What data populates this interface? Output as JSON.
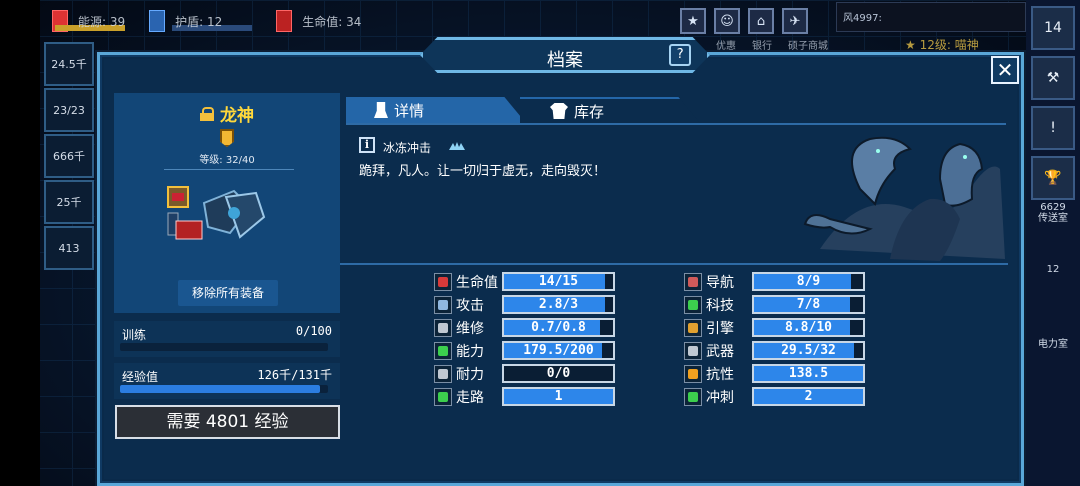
{
  "hud": {
    "energy": "能源: 39",
    "shield": "护盾: 12",
    "health": "生命值: 34",
    "buttons": [
      "★",
      "☺",
      "⌂",
      "✈"
    ],
    "button_labels": [
      "优惠",
      "银行",
      "硕子商城"
    ],
    "player_id": "风4997:",
    "rank": "★ 12级: 喵神"
  },
  "left_side": [
    "24.5千",
    "23/23",
    "666千",
    "25千",
    "413"
  ],
  "right_side": {
    "badge": "14",
    "label_1": "6629",
    "label_2": "传送室",
    "label_3": "电力室",
    "label_4": "12"
  },
  "modal": {
    "title": "档案",
    "help": "?",
    "close": "✕"
  },
  "card": {
    "name": "龙神",
    "level": "等级: 32/40",
    "remove_all": "移除所有装备"
  },
  "training": {
    "label": "训练",
    "value": "0/100",
    "progress": 0
  },
  "experience": {
    "label": "经验值",
    "value": "126千/131千",
    "progress": 0.96
  },
  "need_exp": "需要 4801 经验",
  "tabs": {
    "details": "详情",
    "inventory": "库存"
  },
  "skill": {
    "info": "i",
    "name": "冰冻冲击",
    "quote": "跪拜，凡人。让一切归于虚无，走向毁灭！"
  },
  "stats_left": [
    {
      "label": "生命值",
      "value": "14/15",
      "fill": 0.93,
      "icon": "heart-icon",
      "color": "#d83a3a"
    },
    {
      "label": "攻击",
      "value": "2.8/3",
      "fill": 0.93,
      "icon": "sword-icon",
      "color": "#8fb7e0"
    },
    {
      "label": "维修",
      "value": "0.7/0.8",
      "fill": 0.88,
      "icon": "wrench-icon",
      "color": "#c0c8d2"
    },
    {
      "label": "能力",
      "value": "179.5/200",
      "fill": 0.9,
      "icon": "ability-icon",
      "color": "#3ccf4e"
    },
    {
      "label": "耐力",
      "value": "0/0",
      "fill": 0,
      "icon": "boot-icon",
      "color": "#c0c8d2"
    },
    {
      "label": "走路",
      "value": "1",
      "fill": 1,
      "icon": "walk-icon",
      "color": "#3ccf4e"
    }
  ],
  "stats_right": [
    {
      "label": "导航",
      "value": "8/9",
      "fill": 0.89,
      "icon": "navigation-icon",
      "color": "#d05a5a"
    },
    {
      "label": "科技",
      "value": "7/8",
      "fill": 0.88,
      "icon": "flask-icon",
      "color": "#3ccf4e"
    },
    {
      "label": "引擎",
      "value": "8.8/10",
      "fill": 0.88,
      "icon": "engine-icon",
      "color": "#e0a030"
    },
    {
      "label": "武器",
      "value": "29.5/32",
      "fill": 0.92,
      "icon": "crosshair-icon",
      "color": "#c0c8d2"
    },
    {
      "label": "抗性",
      "value": "138.5",
      "fill": 1,
      "icon": "flame-icon",
      "color": "#f0a020"
    },
    {
      "label": "冲刺",
      "value": "2",
      "fill": 1,
      "icon": "sprint-icon",
      "color": "#3ccf4e"
    }
  ]
}
